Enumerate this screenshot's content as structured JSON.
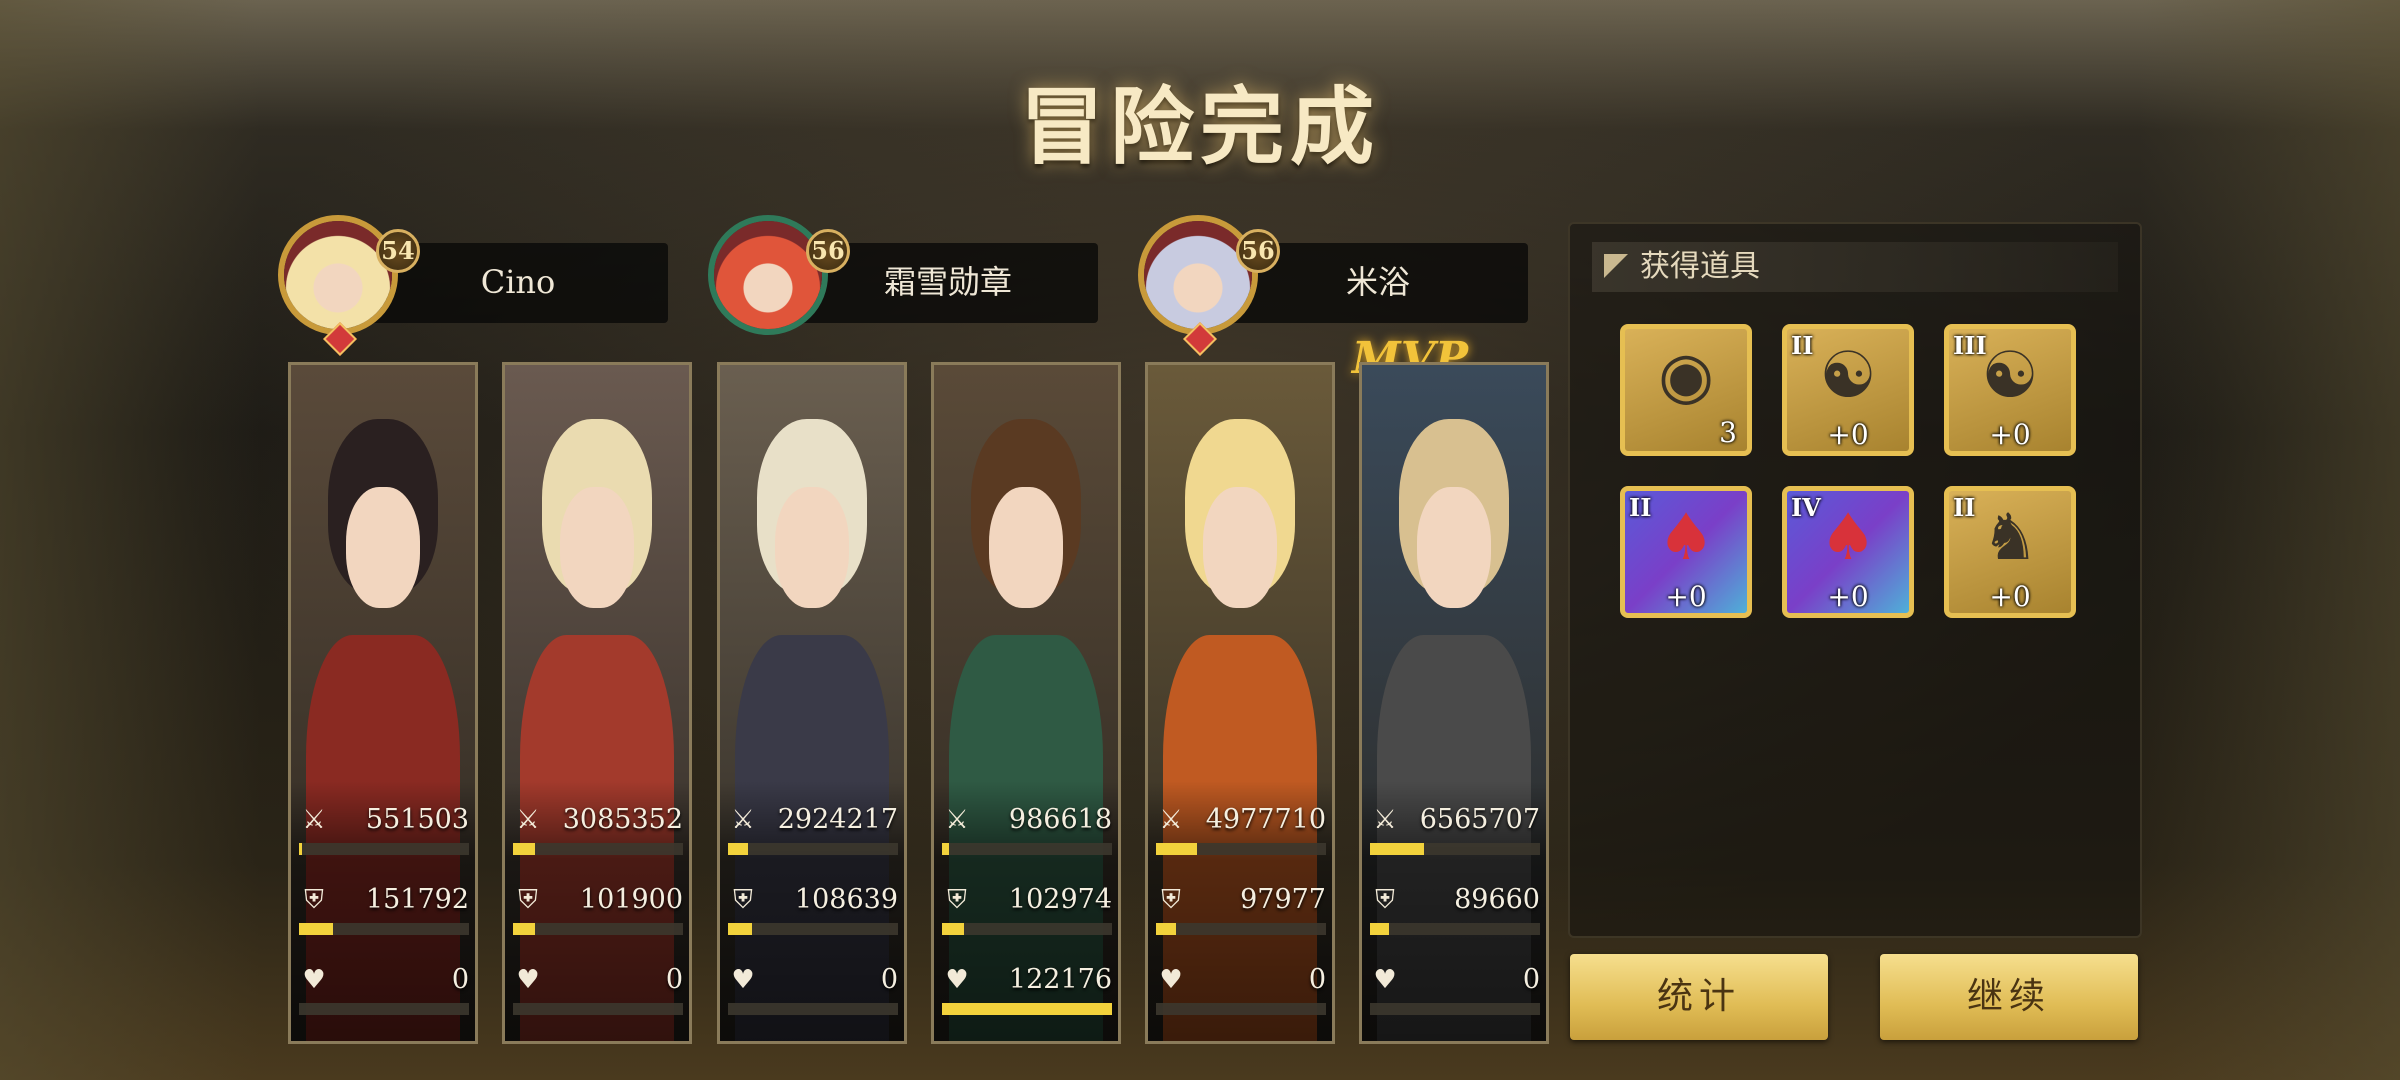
{
  "title": "冒险完成",
  "players": [
    {
      "name": "Cino",
      "level": "54",
      "avatar_hair": "#f3e1a8",
      "frame": "#c89a3a"
    },
    {
      "name": "霜雪勋章",
      "level": "56",
      "avatar_hair": "#e0553a",
      "frame": "#2f7a5a"
    },
    {
      "name": "米浴",
      "level": "56",
      "avatar_hair": "#c8cbe0",
      "frame": "#c89a3a"
    }
  ],
  "mvp_label": "MVP",
  "heroes": [
    {
      "hair": "#2a2020",
      "outfit": "#8a2a22",
      "bg": "#5a4a3a",
      "damage": "551503",
      "damage_pct": 2,
      "defense": "151792",
      "defense_pct": 20,
      "heal": "0",
      "heal_pct": 0
    },
    {
      "hair": "#eadbb0",
      "outfit": "#a33a2c",
      "bg": "#6a5a50",
      "damage": "3085352",
      "damage_pct": 13,
      "defense": "101900",
      "defense_pct": 13,
      "heal": "0",
      "heal_pct": 0
    },
    {
      "hair": "#e8e0c8",
      "outfit": "#3a3a48",
      "bg": "#6a5f50",
      "damage": "2924217",
      "damage_pct": 12,
      "defense": "108639",
      "defense_pct": 14,
      "heal": "0",
      "heal_pct": 0
    },
    {
      "hair": "#5a3a22",
      "outfit": "#2f5a44",
      "bg": "#5a4a38",
      "damage": "986618",
      "damage_pct": 4,
      "defense": "102974",
      "defense_pct": 13,
      "heal": "122176",
      "heal_pct": 100
    },
    {
      "hair": "#f0d890",
      "outfit": "#c05a22",
      "bg": "#6a5a3a",
      "damage": "4977710",
      "damage_pct": 24,
      "defense": "97977",
      "defense_pct": 12,
      "heal": "0",
      "heal_pct": 0
    },
    {
      "hair": "#d8c090",
      "outfit": "#4a4a4a",
      "bg": "#3a4a5a",
      "damage": "6565707",
      "damage_pct": 32,
      "defense": "89660",
      "defense_pct": 11,
      "heal": "0",
      "heal_pct": 0
    }
  ],
  "stat_icons": {
    "damage": "sword-icon",
    "defense": "shield-icon",
    "heal": "heart-icon"
  },
  "items_panel": {
    "title": "获得道具",
    "items": [
      {
        "icon": "film-reel-icon",
        "glyph": "◉",
        "roman": "",
        "label": "3",
        "style": "gold"
      },
      {
        "icon": "yin-yang-rune-icon",
        "glyph": "☯",
        "roman": "II",
        "label": "+0",
        "style": "gold"
      },
      {
        "icon": "yin-yang-rune-icon",
        "glyph": "☯",
        "roman": "III",
        "label": "+0",
        "style": "gold"
      },
      {
        "icon": "poker-cards-icon",
        "glyph": "♠",
        "roman": "II",
        "label": "+0",
        "style": "rainbow"
      },
      {
        "icon": "poker-cards-icon",
        "glyph": "♠",
        "roman": "IV",
        "label": "+0",
        "style": "rainbow"
      },
      {
        "icon": "anubis-mask-icon",
        "glyph": "♞",
        "roman": "II",
        "label": "+0",
        "style": "gold"
      }
    ]
  },
  "buttons": {
    "stats": "统计",
    "continue": "继续"
  }
}
